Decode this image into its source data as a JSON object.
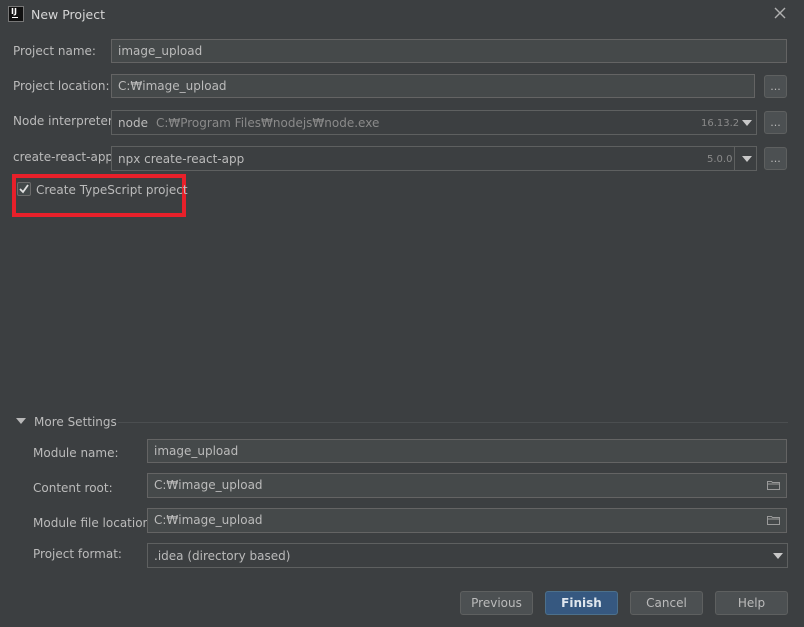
{
  "window": {
    "title": "New Project",
    "app_icon_text": "IJ"
  },
  "form": {
    "project_name": {
      "label": "Project name:",
      "value": "image_upload"
    },
    "project_location": {
      "label": "Project location:",
      "value": "C:₩image_upload"
    },
    "node_interpreter": {
      "label": "Node interpreter:",
      "value": "node",
      "path": "C:₩Program Files₩nodejs₩node.exe",
      "version": "16.13.2"
    },
    "create_react_app": {
      "label": "create-react-app:",
      "value": "npx create-react-app",
      "version": "5.0.0"
    },
    "typescript": {
      "label": "Create TypeScript project",
      "checked": true
    },
    "browse_label": "..."
  },
  "more_settings": {
    "title": "More Settings",
    "module_name": {
      "label": "Module name:",
      "value": "image_upload"
    },
    "content_root": {
      "label": "Content root:",
      "value": "C:₩image_upload"
    },
    "module_file_location": {
      "label": "Module file location:",
      "value": "C:₩image_upload"
    },
    "project_format": {
      "label": "Project format:",
      "value": ".idea (directory based)"
    }
  },
  "buttons": {
    "previous": "Previous",
    "finish": "Finish",
    "cancel": "Cancel",
    "help": "Help"
  },
  "colors": {
    "background": "#3c3f41",
    "primary_button": "#365880",
    "highlight_box": "#e8202a"
  },
  "icons": {
    "close": "close-icon",
    "checkmark": "check-icon",
    "dropdown": "chevron-down-icon",
    "folder": "folder-icon",
    "collapse": "triangle-down-icon"
  }
}
